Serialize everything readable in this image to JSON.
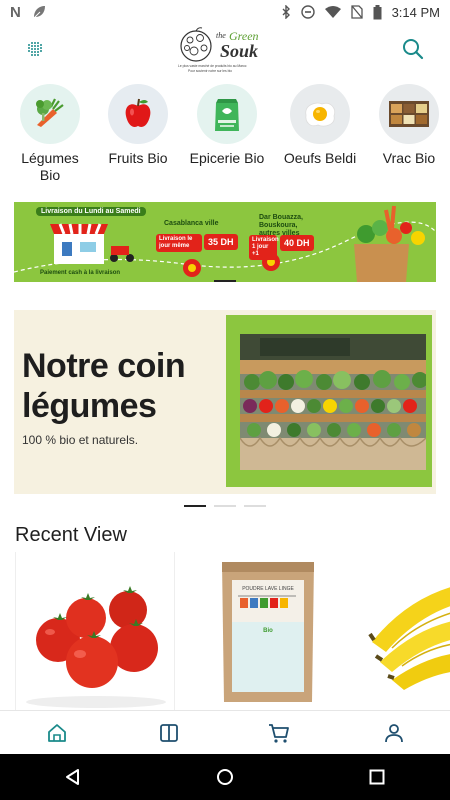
{
  "status_bar": {
    "time": "3:14 PM",
    "left_glyph": "N"
  },
  "header": {
    "logo_line1": "the",
    "logo_green": "Green",
    "logo_souk": "Souk",
    "logo_tagline1": "Le plus vaste marché de produits bio au Maroc",
    "logo_tagline2": "Pour soutenir notre sur les bio"
  },
  "categories": [
    {
      "label": "Légumes Bio"
    },
    {
      "label": "Fruits Bio"
    },
    {
      "label": "Epicerie Bio"
    },
    {
      "label": "Oeufs Beldi"
    },
    {
      "label": "Vrac Bio"
    }
  ],
  "delivery_banner": {
    "title": "Livraison du Lundi au Samedi",
    "city1": "Casablanca ville",
    "tag1": "Livraison le jour même",
    "price1": "35 DH",
    "city2": "Dar Bouazza, Bouskoura, autres villes",
    "tag2": "Livraison 1 jour +1",
    "price2": "40 DH",
    "cash": "Paiement cash à la livraison"
  },
  "hero": {
    "title_line1": "Notre coin",
    "title_line2": "légumes",
    "subtitle": "100 % bio et naturels."
  },
  "recent": {
    "title": "Recent View",
    "product_label_line1": "POUDRE LAVE LINGE",
    "product_label_brand": "Bio"
  },
  "colors": {
    "accent_teal": "#1a8a8a",
    "banner_green": "#8cc63f",
    "hero_bg": "#f6f1e0"
  },
  "icons": {
    "menu": "menu-grid-icon",
    "search": "search-icon",
    "home": "home-icon",
    "catalog": "book-icon",
    "cart": "cart-icon",
    "profile": "user-icon"
  }
}
